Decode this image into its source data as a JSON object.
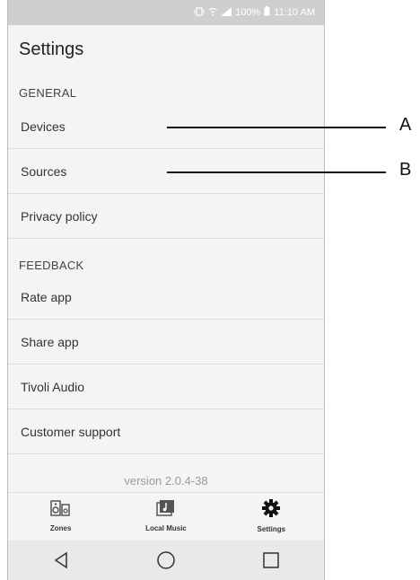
{
  "status_bar": {
    "battery": "100%",
    "time": "11:10 AM"
  },
  "title": "Settings",
  "sections": {
    "general": "GENERAL",
    "feedback": "FEEDBACK"
  },
  "items": {
    "devices": "Devices",
    "sources": "Sources",
    "privacy": "Privacy policy",
    "rate": "Rate app",
    "share": "Share app",
    "tivoli": "Tivoli Audio",
    "support": "Customer support"
  },
  "version": "version 2.0.4-38",
  "tabs": {
    "zones": "Zones",
    "local_music": "Local Music",
    "settings": "Settings"
  },
  "callouts": {
    "a": "A",
    "b": "B"
  }
}
